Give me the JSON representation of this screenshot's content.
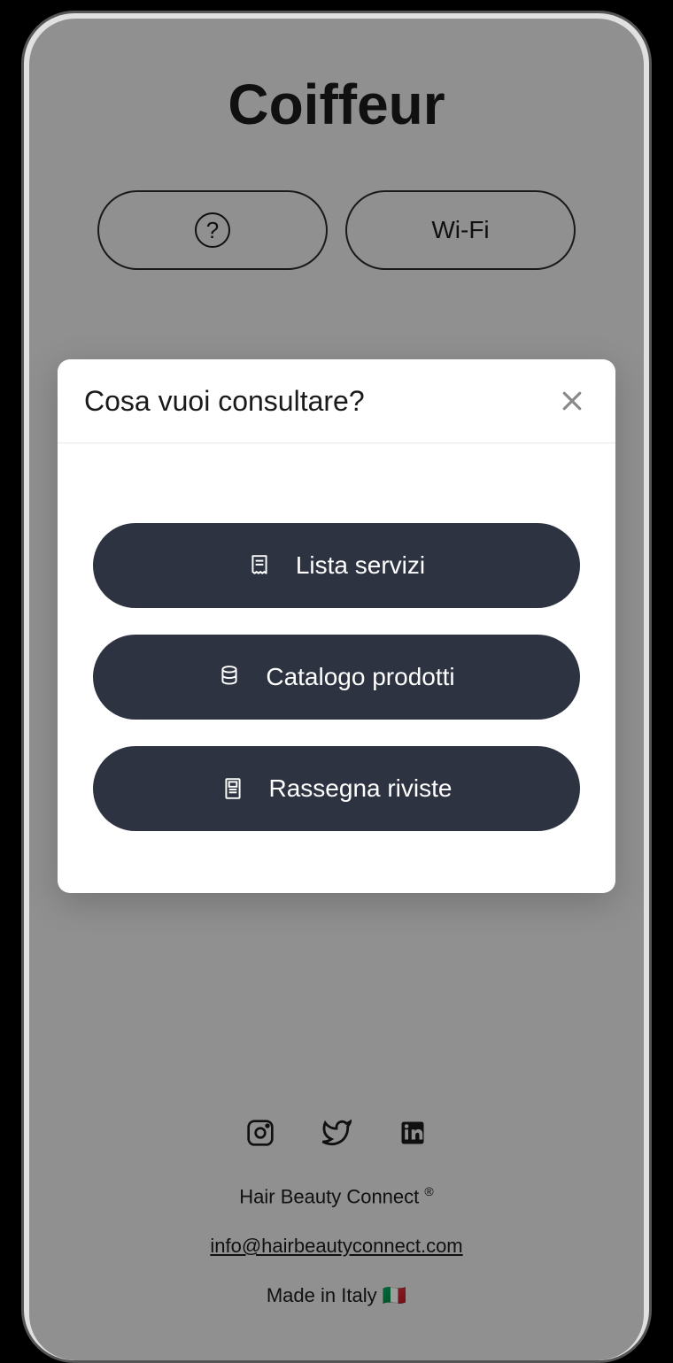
{
  "app": {
    "title": "Coiffeur"
  },
  "header_buttons": {
    "help_symbol": "?",
    "wifi_label": "Wi-Fi"
  },
  "modal": {
    "title": "Cosa vuoi consultare?",
    "options": [
      {
        "label": "Lista servizi",
        "icon": "receipt"
      },
      {
        "label": "Catalogo prodotti",
        "icon": "database"
      },
      {
        "label": "Rassegna riviste",
        "icon": "newspaper"
      }
    ]
  },
  "footer": {
    "company": "Hair Beauty Connect",
    "trademark": "®",
    "email": "info@hairbeautyconnect.com",
    "made_in": "Made in Italy",
    "flag": "🇮🇹",
    "social": [
      "instagram",
      "twitter",
      "linkedin"
    ]
  }
}
